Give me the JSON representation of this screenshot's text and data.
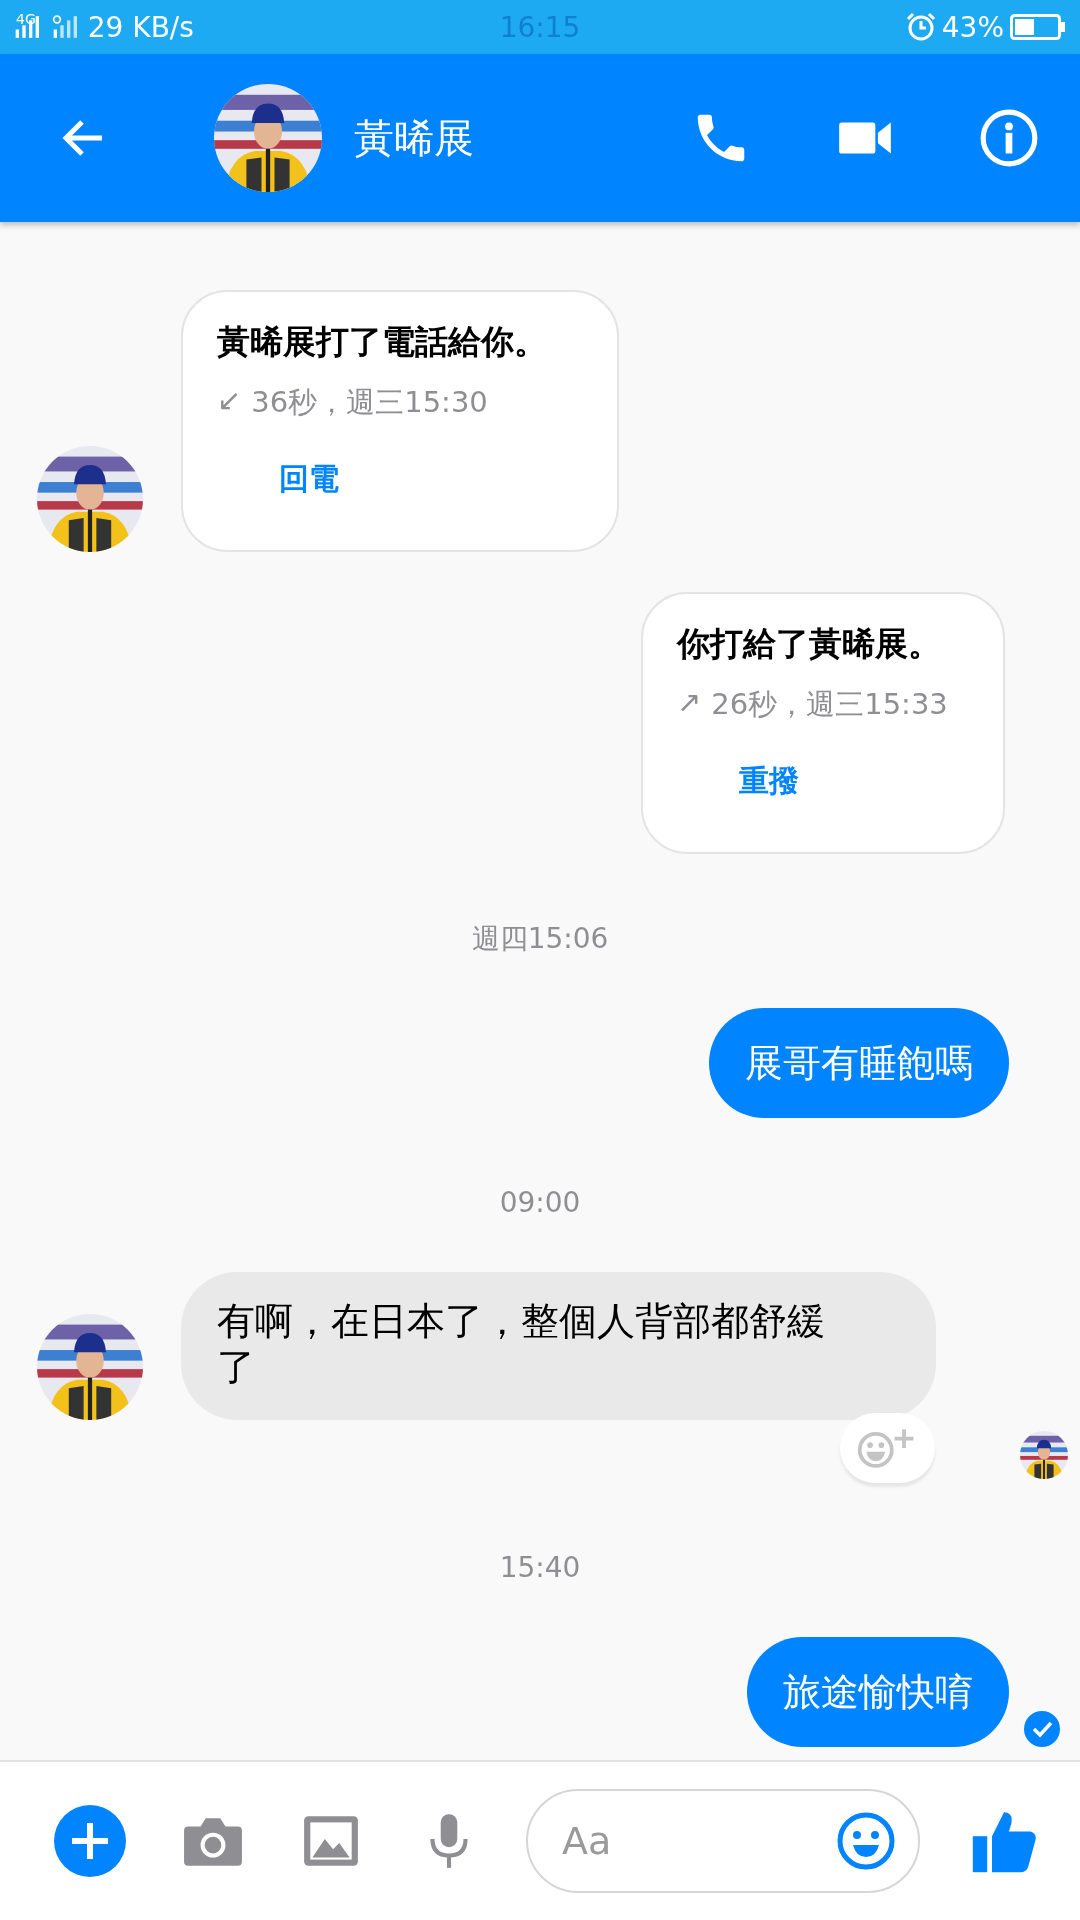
{
  "status_bar": {
    "network": "4G",
    "speed": "29 KB/s",
    "time": "16:15",
    "battery": "43%"
  },
  "header": {
    "title": "黃晞展"
  },
  "messages": [
    {
      "kind": "call",
      "outgoing": false,
      "title": "黃晞展打了電話給你。",
      "detail": "36秒，週三15:30",
      "direction": "↙",
      "action": "回電"
    },
    {
      "kind": "call",
      "outgoing": true,
      "title": "你打給了黃晞展。",
      "detail": "26秒，週三15:33",
      "direction": "↗",
      "action": "重撥"
    },
    {
      "kind": "time",
      "text": "週四15:06"
    },
    {
      "kind": "text",
      "outgoing": true,
      "text": "展哥有睡飽嗎",
      "reaction_button": false,
      "seen_avatar": false,
      "delivered": false
    },
    {
      "kind": "time",
      "text": "09:00"
    },
    {
      "kind": "text",
      "outgoing": false,
      "text": "有啊，在日本了，整個人背部都舒緩了",
      "reaction_button": true,
      "seen_avatar": true,
      "delivered": false
    },
    {
      "kind": "time",
      "text": "15:40"
    },
    {
      "kind": "text",
      "outgoing": true,
      "text": "旅途愉快唷",
      "reaction_button": false,
      "seen_avatar": false,
      "delivered": true
    }
  ],
  "composer": {
    "placeholder": "Aa"
  }
}
